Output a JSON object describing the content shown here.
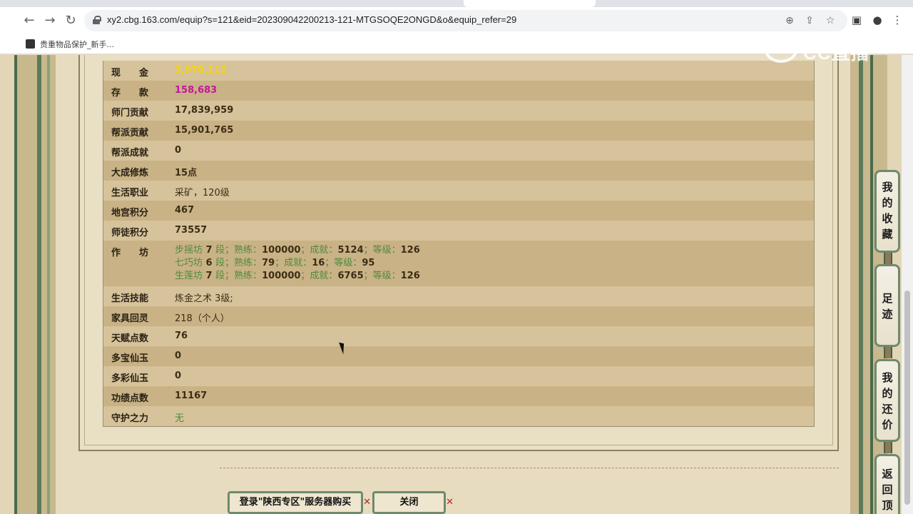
{
  "browser": {
    "url": "xy2.cbg.163.com/equip?s=121&eid=202309042200213-121-MTGSOQE2ONGD&o&equip_refer=29",
    "bookmark_label": "贵重物品保护_新手...",
    "watermark": "CC直播"
  },
  "info": {
    "rows": [
      {
        "key": "现　　金",
        "value": "3,970,112"
      },
      {
        "key": "存　　款",
        "value": "158,683"
      },
      {
        "key": "师门贡献",
        "value": "17,839,959"
      },
      {
        "key": "帮派贡献",
        "value": "15,901,765"
      },
      {
        "key": "帮派成就",
        "value": "0"
      },
      {
        "key": "大成修炼",
        "value": "15点"
      },
      {
        "key": "生活职业",
        "value": "采矿，120级"
      },
      {
        "key": "地宫积分",
        "value": "467"
      },
      {
        "key": "师徒积分",
        "value": "73557"
      }
    ],
    "workshop": {
      "key": "作　　坊",
      "lines": [
        {
          "name": "步摇坊",
          "level": "7",
          "seg": "段；熟练：",
          "skill": "100000",
          "ach_label": "；成就：",
          "ach": "5124",
          "grade_label": "；等级：",
          "grade": "126"
        },
        {
          "name": "七巧坊",
          "level": "6",
          "seg": "段；熟练：",
          "skill": "79",
          "ach_label": "；成就：",
          "ach": "16",
          "grade_label": "；等级：",
          "grade": "95"
        },
        {
          "name": "生莲坊",
          "level": "7",
          "seg": "段；熟练：",
          "skill": "100000",
          "ach_label": "；成就：",
          "ach": "6765",
          "grade_label": "；等级：",
          "grade": "126"
        }
      ]
    },
    "rows2": [
      {
        "key": "生活技能",
        "value": "炼金之术 3级;"
      },
      {
        "key": "家具回灵",
        "value": "218（个人）"
      },
      {
        "key": "天赋点数",
        "value": "76"
      },
      {
        "key": "多宝仙玉",
        "value": "0"
      },
      {
        "key": "多彩仙玉",
        "value": "0"
      },
      {
        "key": "功绩点数",
        "value": "11167"
      },
      {
        "key": "守护之力",
        "value": "无"
      }
    ]
  },
  "actions": {
    "buy_label": "登录\"陕西专区\"服务器购买",
    "close_label": "关闭"
  },
  "sidenav": {
    "favorites": [
      "我",
      "的",
      "收",
      "藏"
    ],
    "footprint": [
      "足",
      "迹"
    ],
    "my_offer": [
      "我",
      "的",
      "还",
      "价"
    ],
    "back_top": [
      "返",
      "回",
      "顶"
    ]
  },
  "colors": {
    "cash": "#f5d410",
    "deposit": "#c2189a",
    "workshop_text": "#4f8a3c"
  }
}
